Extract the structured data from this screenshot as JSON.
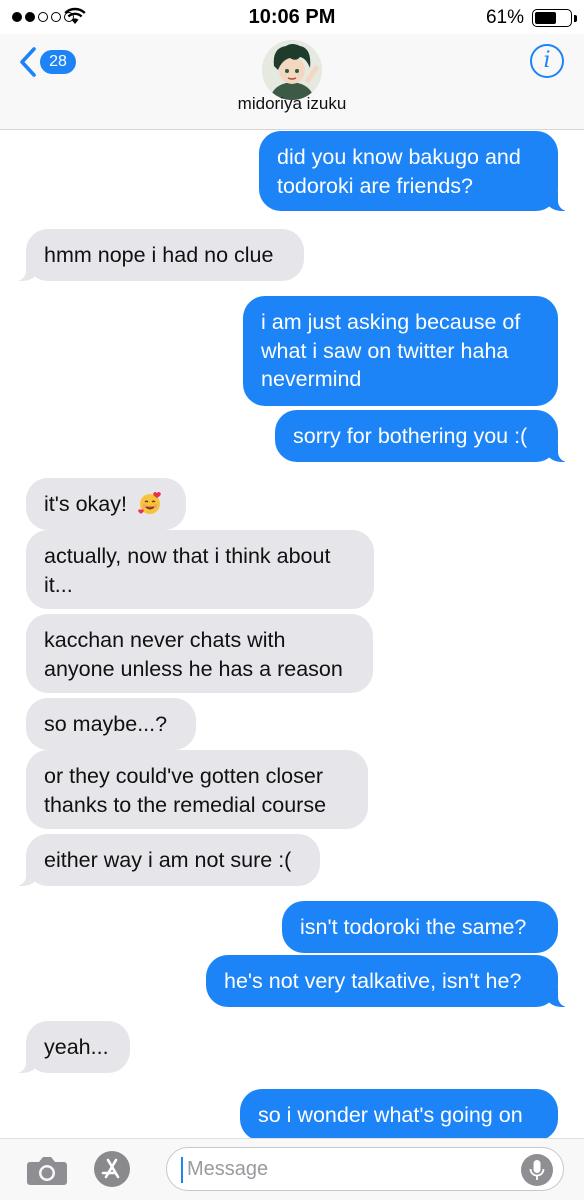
{
  "status_bar": {
    "time": "10:06 PM",
    "battery_percent": "61%",
    "signal_bars_filled": 2,
    "signal_bars_total": 5,
    "battery_level": 0.61
  },
  "header": {
    "back_badge": "28",
    "contact_name": "midoriya izuku",
    "info_icon": "info-icon",
    "avatar_icon": "contact-avatar"
  },
  "messages": [
    {
      "side": "sent",
      "text": "did you know bakugo and\ntodoroki are friends?"
    },
    {
      "side": "recv",
      "text": "hmm nope i had no clue"
    },
    {
      "side": "sent",
      "text": "i am just asking because of\nwhat i saw on twitter haha\nnevermind"
    },
    {
      "side": "sent",
      "text": "sorry for bothering you :("
    },
    {
      "side": "recv",
      "text": "it's okay!"
    },
    {
      "side": "recv",
      "text": "actually, now that i think about\nit..."
    },
    {
      "side": "recv",
      "text": "kacchan never chats with\nanyone unless he has a reason"
    },
    {
      "side": "recv",
      "text": "so maybe...?"
    },
    {
      "side": "recv",
      "text": "or they could've gotten closer\nthanks to the remedial course"
    },
    {
      "side": "recv",
      "text": "either way i am not sure :("
    },
    {
      "side": "sent",
      "text": "isn't todoroki the same?"
    },
    {
      "side": "sent",
      "text": "he's not very talkative, isn't he?"
    },
    {
      "side": "recv",
      "text": "yeah..."
    },
    {
      "side": "sent",
      "text": "so i wonder what's going on"
    }
  ],
  "composer": {
    "placeholder": "Message",
    "camera_icon": "camera-icon",
    "appstore_icon": "app-store-icon",
    "mic_icon": "microphone-icon"
  },
  "colors": {
    "sent_bubble": "#1c84f7",
    "received_bubble": "#e5e5ea",
    "accent": "#1c84f7"
  }
}
